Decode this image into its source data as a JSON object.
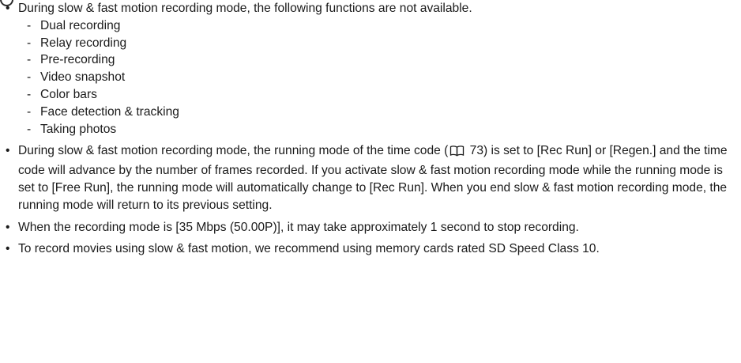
{
  "icons": {
    "page_ref": "book-icon"
  },
  "notes": [
    {
      "text": "During slow & fast motion recording mode, the following functions are not available.",
      "subitems": [
        "Dual recording",
        "Relay recording",
        "Pre-recording",
        "Video snapshot",
        "Color bars",
        "Face detection & tracking",
        "Taking photos"
      ]
    },
    {
      "text_before_ref": "During slow & fast motion recording mode, the running mode of the time code (",
      "ref_page": "73",
      "text_after_ref": ") is set to [Rec Run] or [Regen.] and the time code will advance by the number of frames recorded. If you activate slow & fast motion recording mode while the running mode is set to [Free Run], the running mode will automatically change to [Rec Run]. When you end slow & fast motion recording mode, the running mode will return to its previous setting."
    },
    {
      "text": "When the recording mode is [35 Mbps (50.00P)], it may take approximately 1 second to stop recording."
    },
    {
      "text": "To record movies using slow & fast motion, we recommend using memory cards rated SD Speed Class 10."
    }
  ]
}
